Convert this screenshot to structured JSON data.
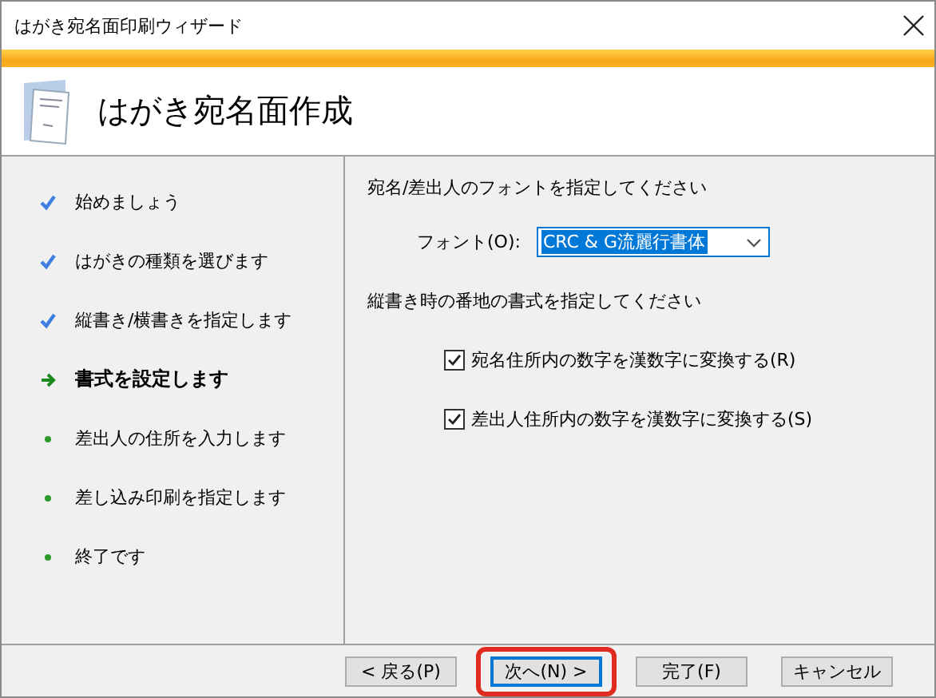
{
  "window": {
    "title": "はがき宛名面印刷ウィザード"
  },
  "header": {
    "title": "はがき宛名面作成"
  },
  "steps": [
    {
      "label": "始めましょう",
      "kind": "done"
    },
    {
      "label": "はがきの種類を選びます",
      "kind": "done"
    },
    {
      "label": "縦書き/横書きを指定します",
      "kind": "done"
    },
    {
      "label": "書式を設定します",
      "kind": "current"
    },
    {
      "label": "差出人の住所を入力します",
      "kind": "pending"
    },
    {
      "label": "差し込み印刷を指定します",
      "kind": "pending"
    },
    {
      "label": "終了です",
      "kind": "pending"
    }
  ],
  "font_section": {
    "heading": "宛名/差出人のフォントを指定してください",
    "label": "フォント(O):",
    "value": "CRC & G流麗行書体",
    "value_selected": true
  },
  "address_section": {
    "heading": "縦書き時の番地の書式を指定してください",
    "options": [
      {
        "label": "宛名住所内の数字を漢数字に変換する(R)",
        "checked": true
      },
      {
        "label": "差出人住所内の数字を漢数字に変換する(S)",
        "checked": true
      }
    ]
  },
  "buttons": [
    {
      "label": "< 戻る(P)",
      "highlighted": false
    },
    {
      "label": "次へ(N) >",
      "highlighted": true
    },
    {
      "label": "完了(F)",
      "highlighted": false
    },
    {
      "label": "キャンセル",
      "highlighted": false
    }
  ]
}
